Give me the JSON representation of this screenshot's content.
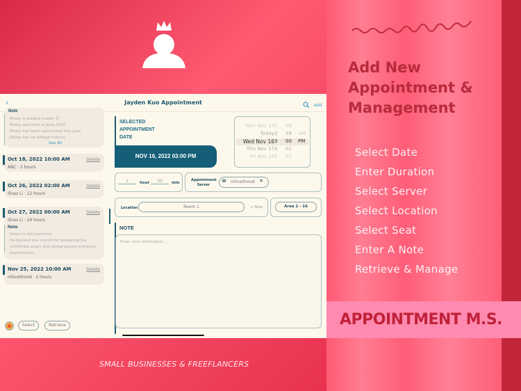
{
  "promo": {
    "headline": "Add New Appointment & Management",
    "features": [
      "Select Date",
      "Enter Duration",
      "Select Server",
      "Select Location",
      "Select Seat",
      "Enter A Note",
      "Retrieve & Manage"
    ],
    "brand": "APPOINTMENT M.S.",
    "tagline": "SMALL BUSINESSES & FREEFLANCERS"
  },
  "colors": {
    "accent": "#1d5a70",
    "background": "#e8324f",
    "banner": "#ff8ab0"
  },
  "app": {
    "title": "Jayden Kuo Appointment",
    "add": "Add",
    "back_icon": "chevron-left-icon",
    "search_icon": "search-icon",
    "first_note": {
      "lines": [
        "Moley is trouble maker 😕",
        "Moley was born in June 2020",
        "Moley has been vaccinated this year",
        "Moley has no allergic history"
      ],
      "see_all": "See All",
      "label": "Note"
    },
    "appointments": [
      {
        "date": "Oct 18, 2022 10:00 AM",
        "sub": "ABC · 2 hours",
        "delete": "Delete"
      },
      {
        "date": "Oct 26, 2022 02:00 AM",
        "sub": "Shao Li · 12 hours",
        "delete": "Delete"
      },
      {
        "date": "Oct 27, 2022 00:00 AM",
        "sub": "Shao Li · 24 hours",
        "delete": "Delete",
        "note_label": "Note",
        "note": "Helen is old customer.\nHe booked one month for preparing his certificate exam and postgraduate entrance examination."
      },
      {
        "date": "Nov 25, 2022 10:00 AM",
        "sub": "mlivelihood · 2 hours",
        "delete": "Delete"
      }
    ],
    "select": "Select",
    "retrieve": "Retrieve",
    "selected_label": "SELECTED APPOINTMENT DATE",
    "selected_value": "NOV 16, 2022 03:00 PM",
    "picker": {
      "days": [
        "Mon Nov 14",
        "Today",
        "Wed Nov 16",
        "Thu Nov 17",
        "Fri Nov 18"
      ],
      "hours": [
        "1",
        "2",
        "3",
        "4",
        "5"
      ],
      "minutes": [
        "58",
        "59",
        "00",
        "01",
        "02"
      ],
      "ampm": [
        "AM",
        "PM"
      ]
    },
    "duration": {
      "hour": "1",
      "hour_label": "hour",
      "min": "30",
      "min_label": "min"
    },
    "server": {
      "label": "Appointment Server",
      "initial": "M",
      "name": "mlivelihood"
    },
    "location": {
      "label": "Location",
      "value": "Room 1",
      "new": "+ New",
      "seat": "Area 2 - 16"
    },
    "note": {
      "label": "NOTE",
      "placeholder": "Enter note information ..."
    }
  }
}
